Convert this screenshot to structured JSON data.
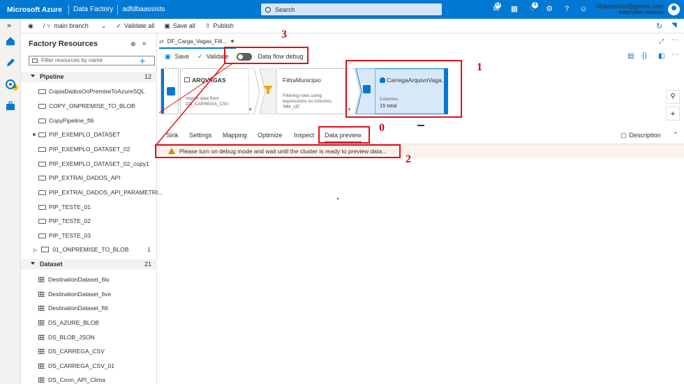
{
  "topbar": {
    "brand": "Microsoft Azure",
    "service": "Data Factory",
    "factory": "adfdbaassists",
    "search_placeholder": "Search",
    "notif_count_1": "23",
    "notif_count_2": "4",
    "user_email": "dbaassists@gmail.com",
    "user_dir": "DIRETÓRIO PADRÃO"
  },
  "rail": {
    "badge": "2"
  },
  "subtoolbar": {
    "branch": "main branch",
    "validate_all": "Validate all",
    "save_all": "Save all",
    "publish": "Publish"
  },
  "resources": {
    "title": "Factory Resources",
    "filter_placeholder": "Filter resources by name",
    "pipeline": {
      "label": "Pipeline",
      "count": "12",
      "items": [
        "CopiaDadosOnPremiseToAzureSQL",
        "COPY_ONPREMISE_TO_BLOB",
        "CopyPipeline_ft6",
        "PIP_EXEMPLO_DATASET",
        "PIP_EXEMPLO_DATASET_02",
        "PIP_EXEMPLO_DATASET_02_copy1",
        "PIP_EXTRAI_DADOS_API",
        "PIP_EXTRAI_DADOS_API_PARAMETRI...",
        "PIP_TESTE_01",
        "PIP_TESTE_02",
        "PIP_TESTE_03"
      ]
    },
    "folder": {
      "label": "01_ONPREMISE_TO_BLOB",
      "count": "1"
    },
    "dataset": {
      "label": "Dataset",
      "count": "21",
      "items": [
        "DestinationDataset_6lu",
        "DestinationDataset_6ve",
        "DestinationDataset_ft6",
        "DS_AZURE_BLOB",
        "DS_BLOB_JSON",
        "DS_CARREGA_CSV",
        "DS_CARREGA_CSV_01",
        "DS_Conn_API_Clima"
      ]
    }
  },
  "editor": {
    "tab_title": "DF_Carga_Vagas_Filt...",
    "save": "Save",
    "validate": "Validate",
    "debug_label": "Data flow debug"
  },
  "nodes": {
    "source": {
      "title": "ARQVAGAS",
      "line1": "Import data from",
      "line2": "DS_CARREGA_CSV"
    },
    "filter": {
      "title": "FiltraMunicipio",
      "line1": "Filtering rows using",
      "line2": "expressions on columns",
      "line3": "'NM_UE'"
    },
    "sink": {
      "title": "CarregaArquivoVaga...",
      "columns_label": "Columns:",
      "columns_value": "15 total"
    }
  },
  "tabs": [
    "Sink",
    "Settings",
    "Mapping",
    "Optimize",
    "Inspect",
    "Data preview"
  ],
  "description_label": "Description",
  "warning_text": "Please turn on debug mode and wait until the cluster is ready to preview data...",
  "annotations": {
    "n0": "0",
    "n1": "1",
    "n2": "2",
    "n3": "3"
  }
}
